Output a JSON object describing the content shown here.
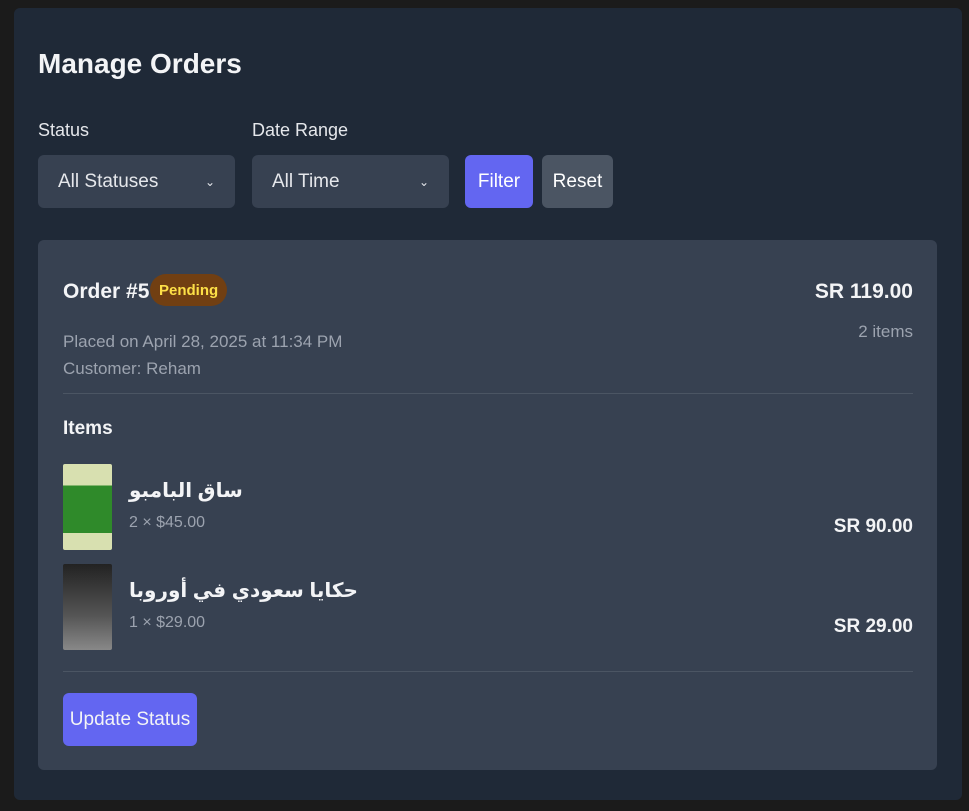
{
  "page_title": "Manage Orders",
  "filters": {
    "status_label": "Status",
    "status_value": "All Statuses",
    "date_label": "Date Range",
    "date_value": "All Time",
    "filter_button": "Filter",
    "reset_button": "Reset"
  },
  "order": {
    "title": "Order #5",
    "status": "Pending",
    "placed": "Placed on April 28, 2025 at 11:34 PM",
    "customer": "Customer: Reham",
    "total": "SR 119.00",
    "item_count": "2 items",
    "items_heading": "Items",
    "items": [
      {
        "name": "ساق البامبو",
        "qty": "2 × $45.00",
        "price": "SR 90.00"
      },
      {
        "name": "حكايا سعودي في أوروبا",
        "qty": "1 × $29.00",
        "price": "SR 29.00"
      }
    ],
    "update_button": "Update Status"
  },
  "colors": {
    "accent": "#6366f1",
    "badge_bg": "#713f12",
    "badge_text": "#fde047"
  }
}
